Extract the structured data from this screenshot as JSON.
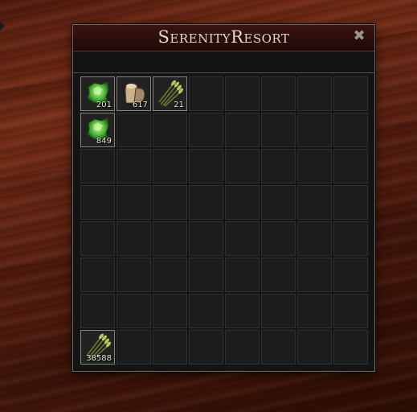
{
  "window": {
    "title": "SerenityResort",
    "close_symbol": "✖"
  },
  "slots": [
    {
      "index": 0,
      "icon": "green-crystal-icon",
      "qty": "201"
    },
    {
      "index": 1,
      "icon": "sack-bread-icon",
      "qty": "617"
    },
    {
      "index": 2,
      "icon": "wheat-bundle-icon",
      "qty": "21"
    },
    {
      "index": 8,
      "icon": "green-crystal-icon",
      "qty": "849"
    },
    {
      "index": 56,
      "icon": "wheat-bundle-icon",
      "qty": "38588"
    }
  ],
  "grid": {
    "columns": 8,
    "rows": 8
  },
  "colors": {
    "title": "#e2d9c8",
    "titlebar": "#2a0d0a",
    "slot": "#1c1c1c"
  }
}
